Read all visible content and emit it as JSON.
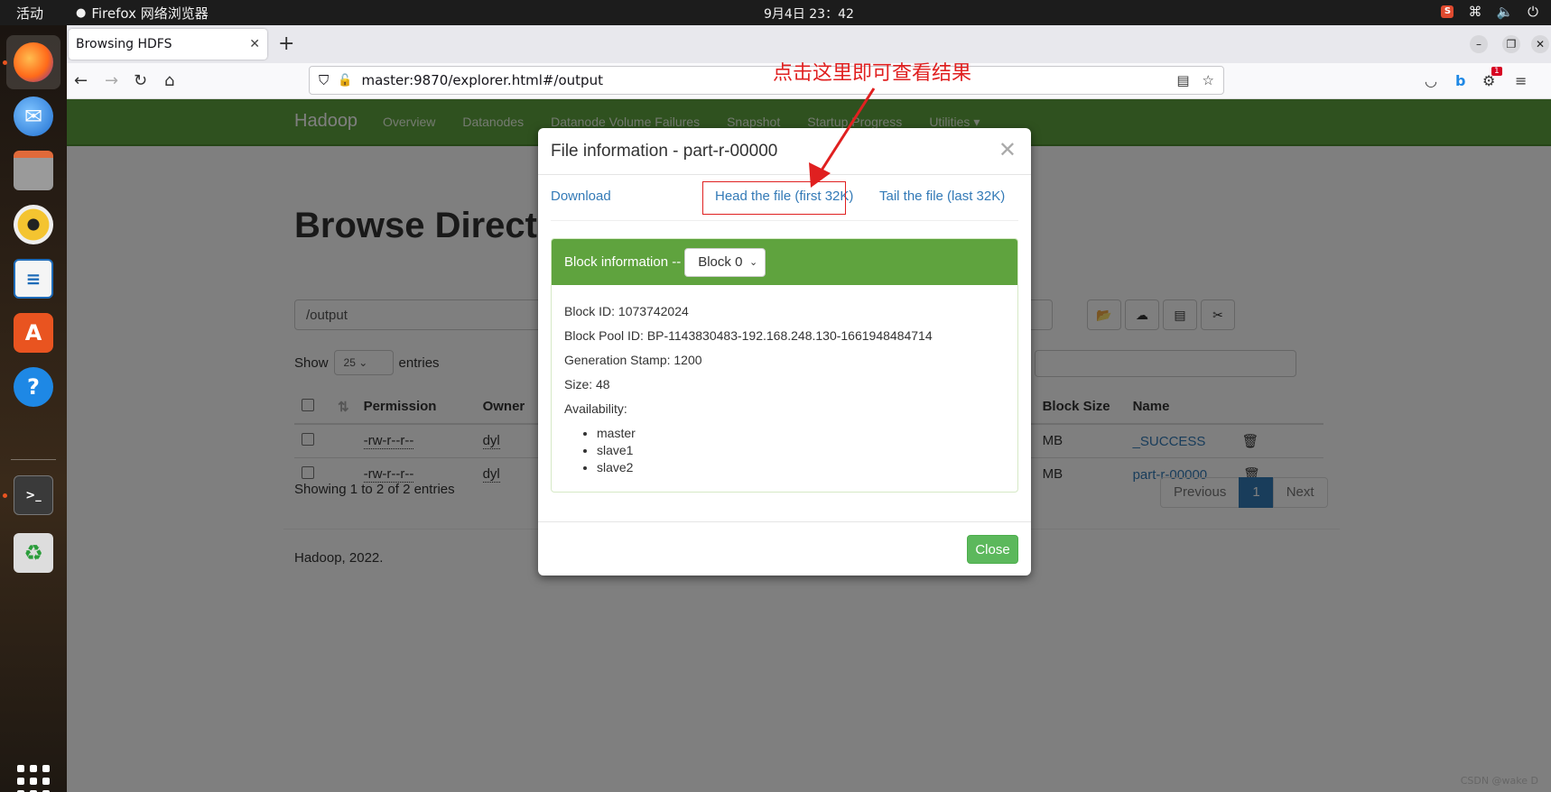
{
  "topbar": {
    "activities": "活动",
    "app_name": "Firefox 网络浏览器",
    "clock": "9月4日 23：42"
  },
  "browser": {
    "tab_title": "Browsing HDFS",
    "url": "master:9870/explorer.html#/output",
    "notification_badge": "1"
  },
  "hadoop": {
    "brand": "Hadoop",
    "nav": [
      "Overview",
      "Datanodes",
      "Datanode Volume Failures",
      "Snapshot",
      "Startup Progress",
      "Utilities"
    ],
    "heading": "Browse Director",
    "path": "/output",
    "show_label": "Show",
    "entries_count": "25",
    "entries_label": "entries",
    "columns": [
      "Permission",
      "Owner",
      "Block Size",
      "Name"
    ],
    "rows": [
      {
        "permission": "-rw-r--r--",
        "owner": "dyl",
        "block_size": "MB",
        "name": "_SUCCESS"
      },
      {
        "permission": "-rw-r--r--",
        "owner": "dyl",
        "block_size": "MB",
        "name": "part-r-00000"
      }
    ],
    "showing": "Showing 1 to 2 of 2 entries",
    "pager": {
      "previous": "Previous",
      "page": "1",
      "next": "Next"
    },
    "footer": "Hadoop, 2022."
  },
  "modal": {
    "title": "File information - part-r-00000",
    "download": "Download",
    "head": "Head the file (first 32K)",
    "tail": "Tail the file (last 32K)",
    "block_info_label": "Block information --",
    "block_select": "Block 0",
    "block_id": "Block ID: 1073742024",
    "block_pool": "Block Pool ID: BP-1143830483-192.168.248.130-1661948484714",
    "gen_stamp": "Generation Stamp: 1200",
    "size": "Size: 48",
    "availability": "Availability:",
    "nodes": [
      "master",
      "slave1",
      "slave2"
    ],
    "close": "Close"
  },
  "annotation": "点击这里即可查看结果",
  "watermark": "CSDN @wake D",
  "colors": {
    "hadoop_green": "#5fa33e",
    "link": "#337ab7",
    "annotation_red": "#e02020"
  }
}
